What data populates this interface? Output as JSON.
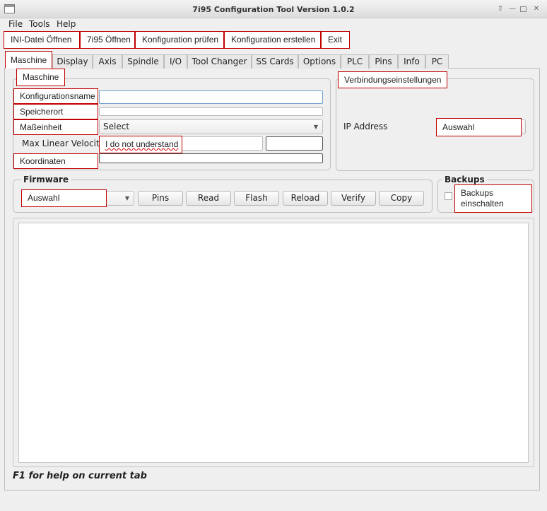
{
  "window": {
    "title": "7i95 Configuration Tool Version 1.0.2"
  },
  "menu": {
    "file": "File",
    "tools": "Tools",
    "help": "Help"
  },
  "toolbar": {
    "open_ini": "INI-Datei Öffnen",
    "open_7i95": "7i95 Öffnen",
    "check_config": "Konfiguration prüfen",
    "build_config": "Konfiguration erstellen",
    "exit": "Exit"
  },
  "tabs": [
    "Maschine",
    "Display",
    "Axis",
    "Spindle",
    "I/O",
    "Tool Changer",
    "SS Cards",
    "Options",
    "PLC",
    "Pins",
    "Info",
    "PC"
  ],
  "machine": {
    "group_title": "Maschine",
    "config_name_label": "Konfigurationsname",
    "config_name_value": "",
    "location_label": "Speicherort",
    "units_label": "Maßeinheit",
    "units_value": "Select",
    "max_linear_velocity_label": "Max Linear Velocity",
    "max_linear_velocity_note": "I do not understand",
    "coordinates_label": "Koordinaten"
  },
  "connection": {
    "group_title": "Verbindungseinstellungen",
    "ip_label": "IP Address",
    "ip_value": "Auswahl"
  },
  "firmware": {
    "group_title": "Firmware",
    "select_value": "Auswahl",
    "pins": "Pins",
    "read": "Read",
    "flash": "Flash",
    "reload": "Reload",
    "verify": "Verify",
    "copy": "Copy"
  },
  "backups": {
    "group_title": "Backups",
    "enable_label": "Backups einschalten"
  },
  "status": {
    "help_text": "F1 for help on current tab"
  }
}
